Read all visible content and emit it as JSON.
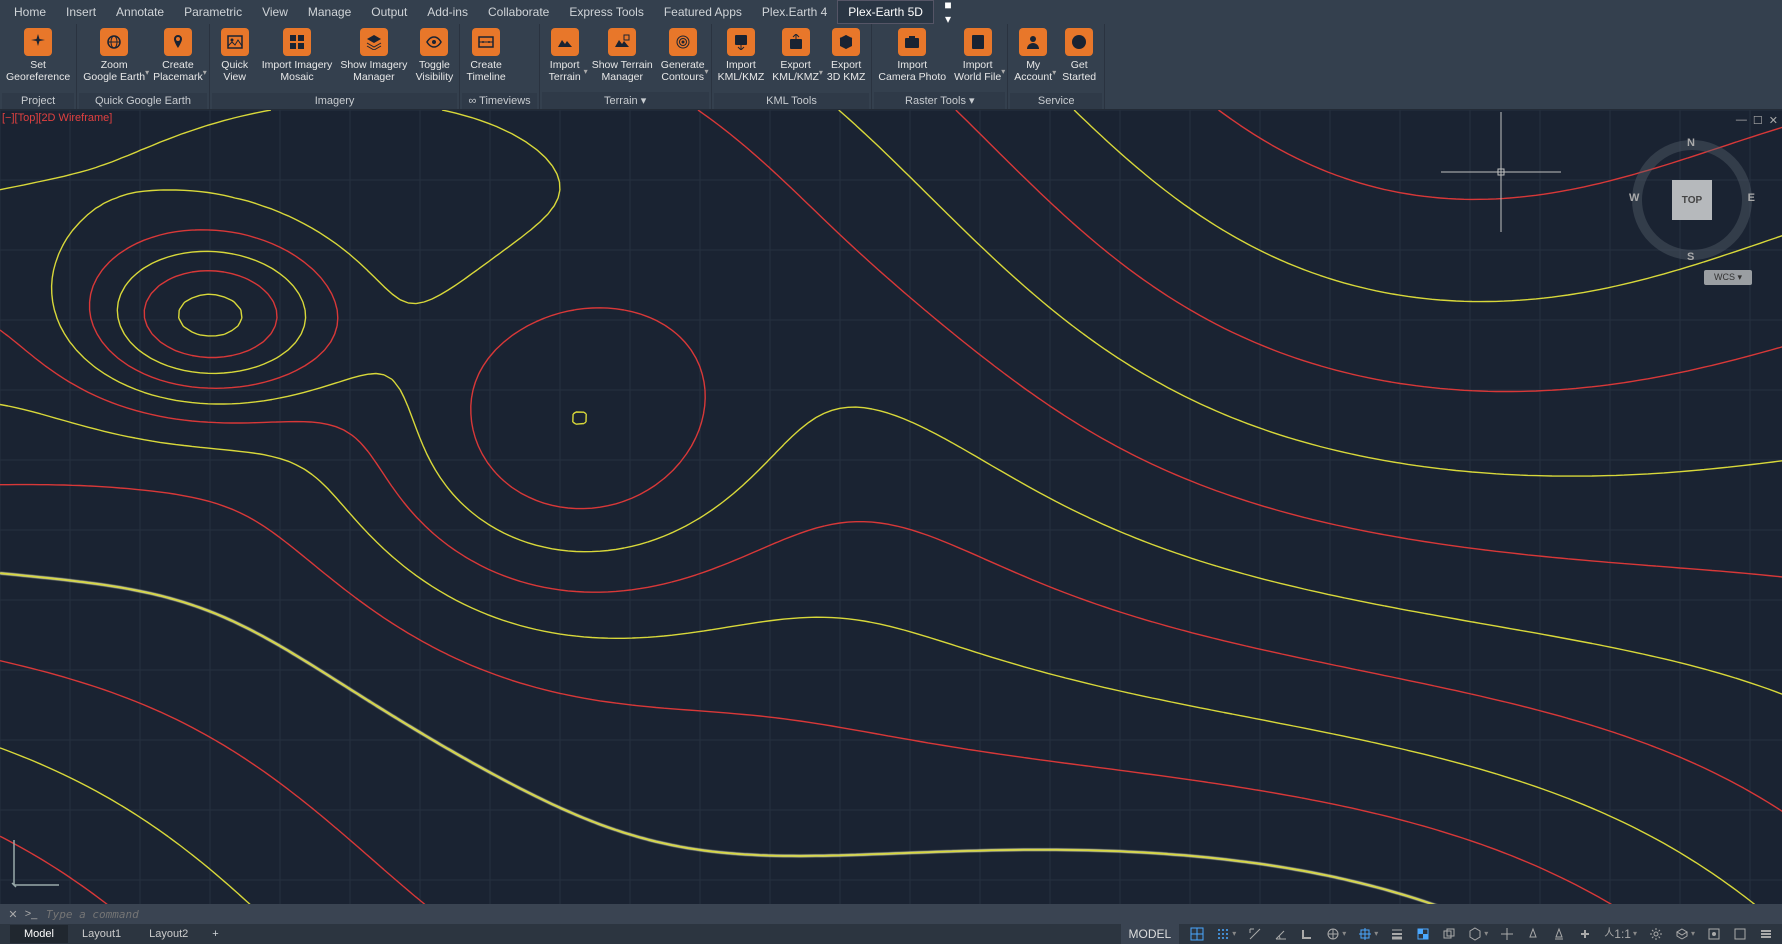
{
  "menu": {
    "items": [
      "Home",
      "Insert",
      "Annotate",
      "Parametric",
      "View",
      "Manage",
      "Output",
      "Add-ins",
      "Collaborate",
      "Express Tools",
      "Featured Apps",
      "Plex.Earth 4",
      "Plex-Earth 5D"
    ],
    "activeIndex": 12,
    "starIcon": "▾"
  },
  "ribbon": {
    "panels": [
      {
        "name": "Project",
        "buttons": [
          {
            "label": "Set\nGeoreference",
            "icon": "sparkle"
          }
        ]
      },
      {
        "name": "Quick Google Earth",
        "buttons": [
          {
            "label": "Zoom\nGoogle Earth",
            "icon": "globe",
            "dd": true
          },
          {
            "label": "Create\nPlacemark",
            "icon": "pin",
            "dd": true
          }
        ]
      },
      {
        "name": "Imagery",
        "buttons": [
          {
            "label": "Quick\nView",
            "icon": "image"
          },
          {
            "label": "Import Imagery\nMosaic",
            "icon": "grid"
          },
          {
            "label": "Show Imagery\nManager",
            "icon": "layers"
          },
          {
            "label": "Toggle\nVisibility",
            "icon": "eye"
          }
        ]
      },
      {
        "name": "∞ Timeviews",
        "buttons": [
          {
            "label": "Create\nTimeline",
            "icon": "timeline"
          }
        ]
      },
      {
        "name": "Terrain  ▾",
        "buttons": [
          {
            "label": "Import\nTerrain",
            "icon": "terrain",
            "dd": true
          },
          {
            "label": "Show Terrain\nManager",
            "icon": "terrmgr"
          },
          {
            "label": "Generate\nContours",
            "icon": "contour",
            "dd": true
          }
        ]
      },
      {
        "name": "KML Tools",
        "buttons": [
          {
            "label": "Import\nKML/KMZ",
            "icon": "kmlin"
          },
          {
            "label": "Export\nKML/KMZ",
            "icon": "kmlout",
            "dd": true
          },
          {
            "label": "Export\n3D KMZ",
            "icon": "kml3d"
          }
        ]
      },
      {
        "name": "Raster Tools  ▾",
        "buttons": [
          {
            "label": "Import\nCamera Photo",
            "icon": "camera"
          },
          {
            "label": "Import\nWorld File",
            "icon": "world",
            "dd": true
          }
        ]
      },
      {
        "name": "Service",
        "buttons": [
          {
            "label": "My\nAccount",
            "icon": "user",
            "dd": true
          },
          {
            "label": "Get\nStarted",
            "icon": "play"
          }
        ]
      }
    ]
  },
  "viewport": {
    "label": "[−][Top][2D Wireframe]",
    "windowControls": [
      "—",
      "☐",
      "✕"
    ],
    "viewcubeFace": "TOP",
    "compass": {
      "n": "N",
      "s": "S",
      "e": "E",
      "w": "W"
    },
    "wcs": "WCS ▾"
  },
  "command": {
    "placeholder": "Type a command",
    "prompt": ">_"
  },
  "tabs": {
    "items": [
      "Model",
      "Layout1",
      "Layout2"
    ],
    "activeIndex": 0,
    "plus": "+"
  },
  "status": {
    "modelLabel": "MODEL",
    "scale": "1:1",
    "icons": [
      {
        "name": "grid",
        "on": true
      },
      {
        "name": "snap",
        "on": true,
        "dd": true
      },
      {
        "name": "infer",
        "on": false
      },
      {
        "name": "angle",
        "on": false
      },
      {
        "name": "ortho",
        "on": false
      },
      {
        "name": "polar",
        "on": false,
        "dd": true
      },
      {
        "name": "osnap",
        "on": true,
        "dd": true
      },
      {
        "name": "lineweight",
        "on": false
      },
      {
        "name": "transparency",
        "on": true
      },
      {
        "name": "cycle",
        "on": false
      },
      {
        "name": "3dsnap",
        "on": false,
        "dd": true
      },
      {
        "name": "dyn",
        "on": false
      },
      {
        "name": "ann",
        "on": false
      },
      {
        "name": "annscale",
        "on": false
      },
      {
        "name": "plus",
        "on": false
      }
    ],
    "trailing": [
      {
        "name": "gear"
      },
      {
        "name": "iso",
        "dd": true
      },
      {
        "name": "config"
      },
      {
        "name": "fullscreen"
      },
      {
        "name": "customize"
      }
    ]
  },
  "colors": {
    "accent": "#e8772a",
    "contourMajor": "#d8d83a",
    "contourMinor": "#d83838",
    "bg": "#1a2332"
  }
}
